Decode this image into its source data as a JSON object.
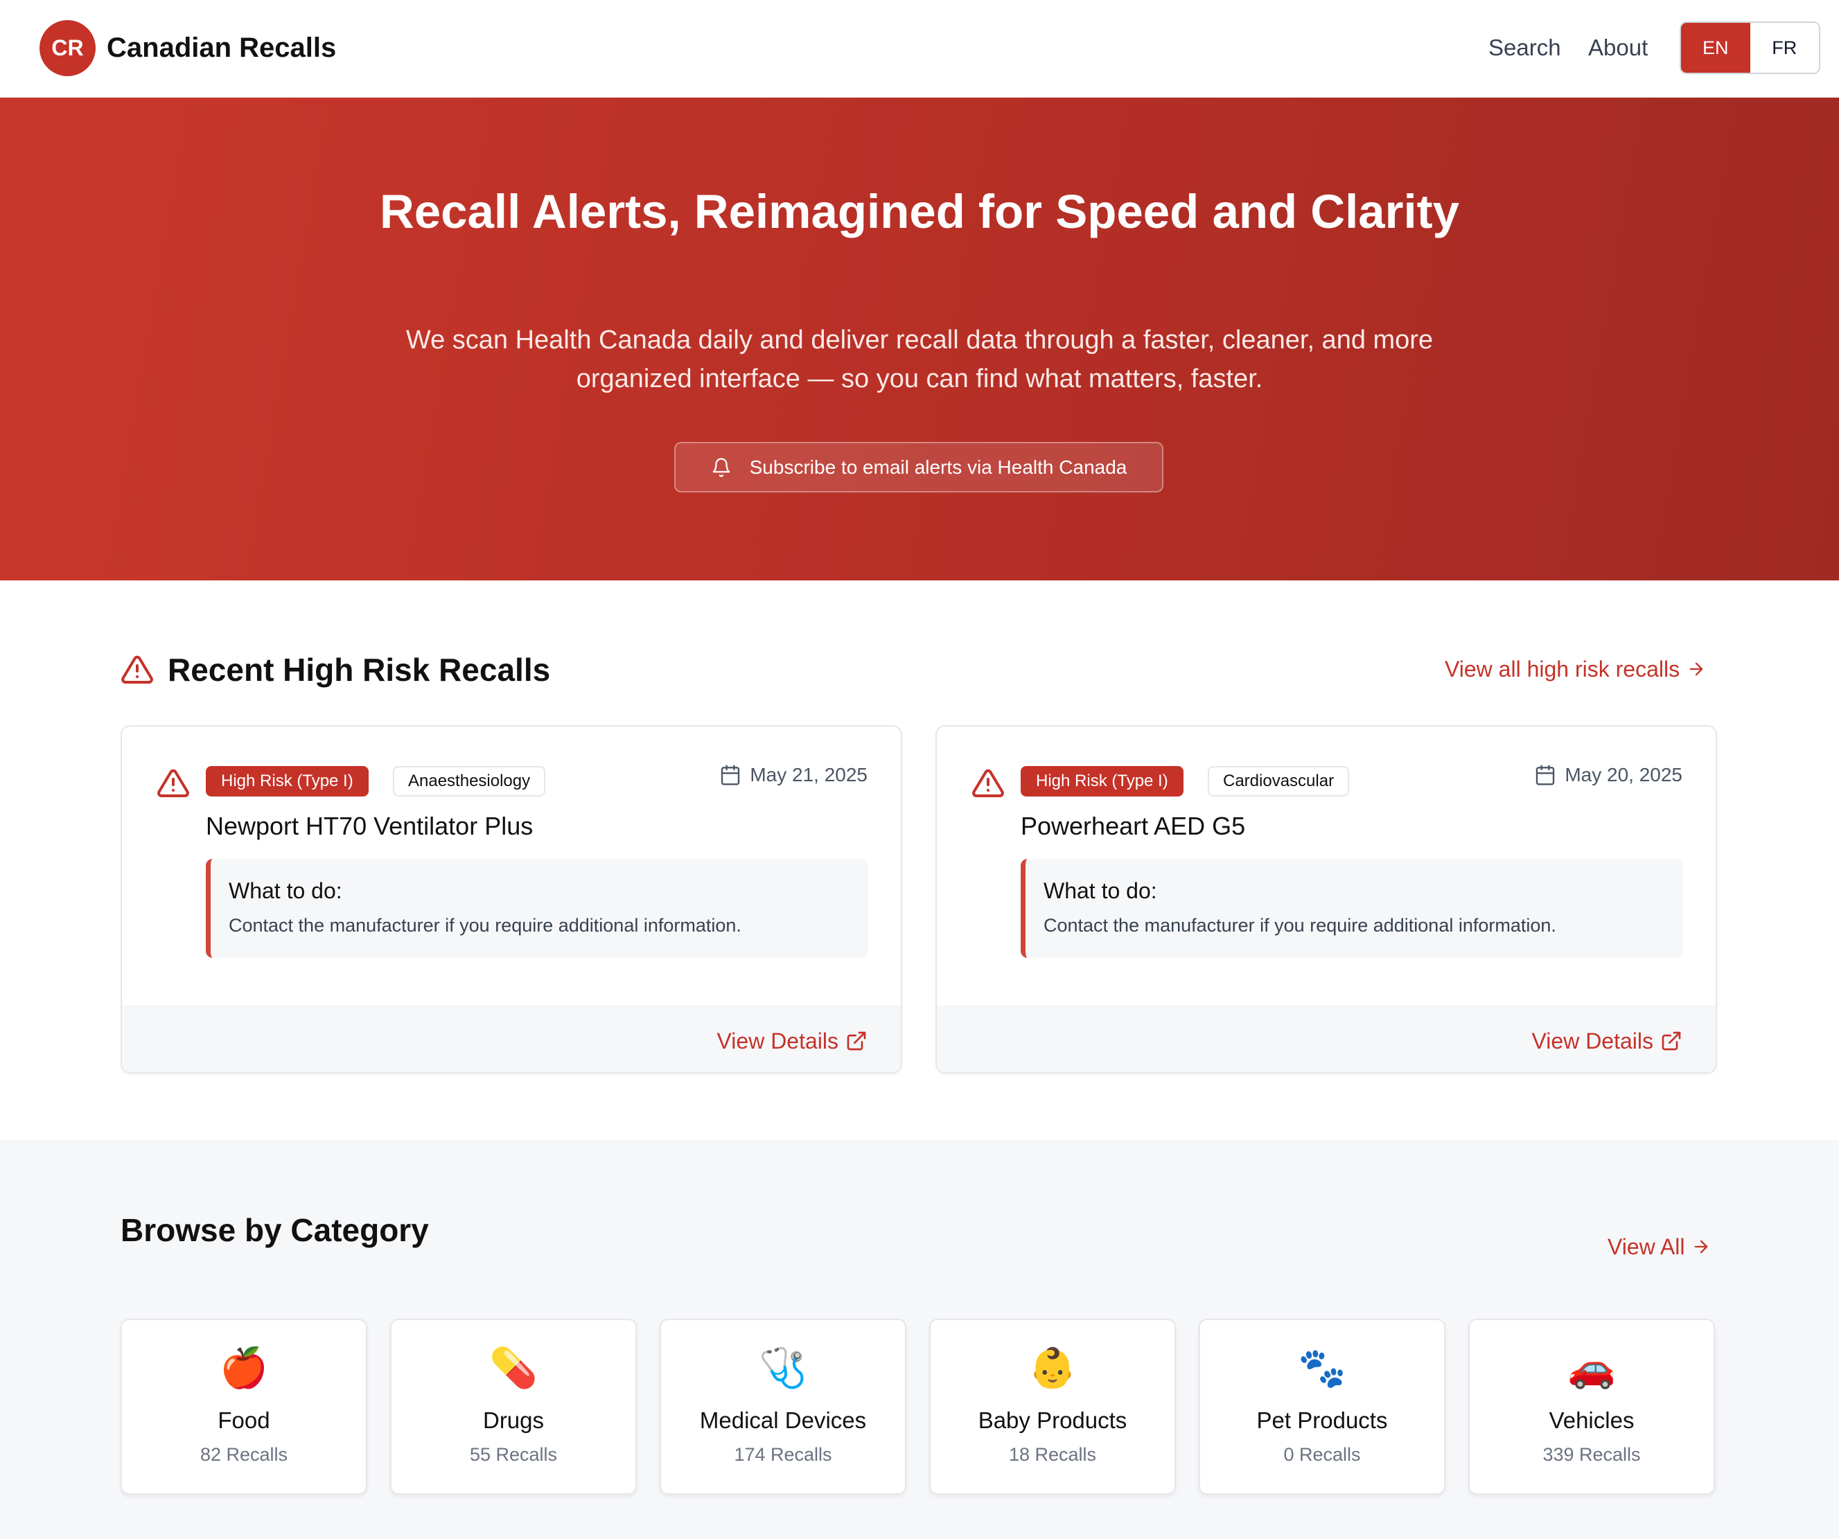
{
  "header": {
    "logo_text": "CR",
    "brand": "Canadian Recalls",
    "nav": {
      "search": "Search",
      "about": "About"
    },
    "lang": {
      "en": "EN",
      "fr": "FR",
      "active": "EN"
    }
  },
  "hero": {
    "title": "Recall Alerts, Reimagined for Speed and Clarity",
    "subtitle": "We scan Health Canada daily and deliver recall data through a faster, cleaner, and more organized interface — so you can find what matters, faster.",
    "subscribe_label": "Subscribe to email alerts via Health Canada",
    "subscribe_icon": "bell-icon"
  },
  "recent": {
    "title": "Recent High Risk Recalls",
    "view_all": "View all high risk recalls",
    "cards": [
      {
        "risk": "High Risk (Type I)",
        "category": "Anaesthesiology",
        "date": "May 21, 2025",
        "product": "Newport HT70 Ventilator Plus",
        "todo_title": "What to do:",
        "todo_text": "Contact the manufacturer if you require additional information.",
        "details": "View Details"
      },
      {
        "risk": "High Risk (Type I)",
        "category": "Cardiovascular",
        "date": "May 20, 2025",
        "product": "Powerheart AED G5",
        "todo_title": "What to do:",
        "todo_text": "Contact the manufacturer if you require additional information.",
        "details": "View Details"
      }
    ]
  },
  "categories": {
    "title": "Browse by Category",
    "view_all": "View All",
    "items": [
      {
        "icon": "🍎",
        "icon_name": "apple-icon",
        "name": "Food",
        "count": "82 Recalls"
      },
      {
        "icon": "💊",
        "icon_name": "pill-icon",
        "name": "Drugs",
        "count": "55 Recalls"
      },
      {
        "icon": "🩺",
        "icon_name": "stethoscope-icon",
        "name": "Medical Devices",
        "count": "174 Recalls"
      },
      {
        "icon": "👶",
        "icon_name": "baby-icon",
        "name": "Baby Products",
        "count": "18 Recalls"
      },
      {
        "icon": "🐾",
        "icon_name": "paw-icon",
        "name": "Pet Products",
        "count": "0 Recalls"
      },
      {
        "icon": "🚗",
        "icon_name": "car-icon",
        "name": "Vehicles",
        "count": "339 Recalls"
      }
    ]
  },
  "colors": {
    "accent": "#c53228",
    "muted_bg": "#f6f7f9"
  }
}
